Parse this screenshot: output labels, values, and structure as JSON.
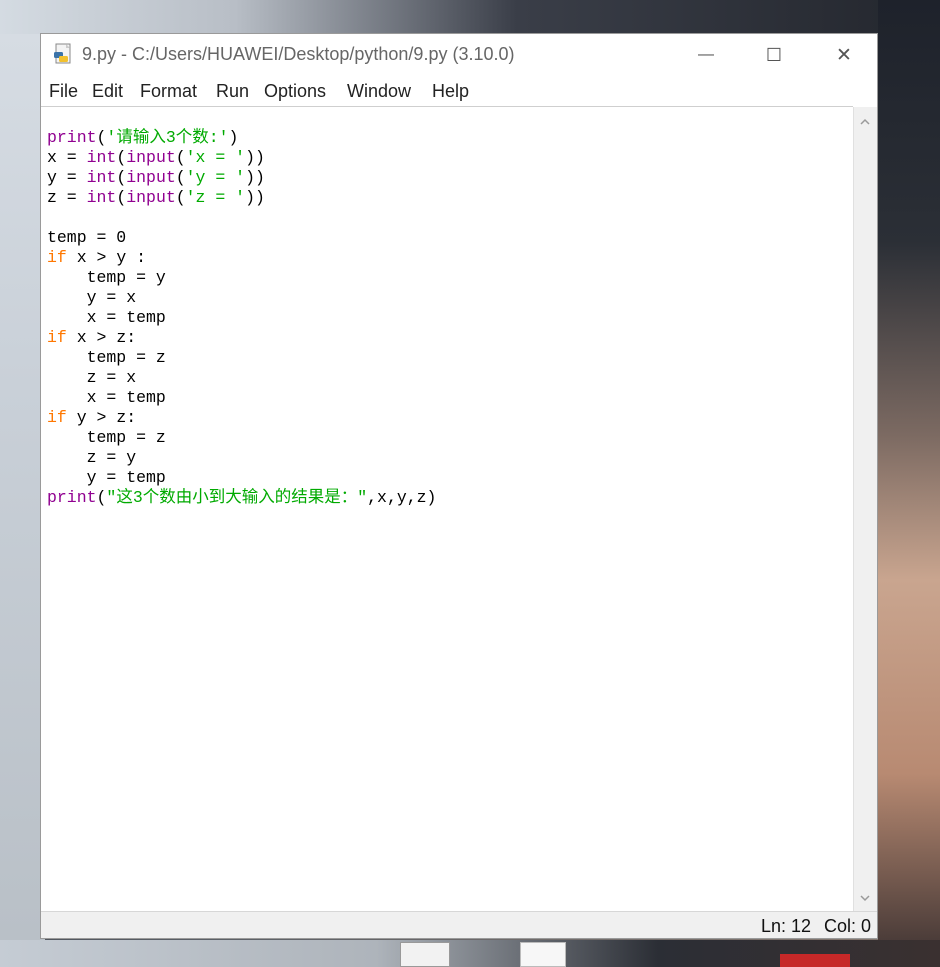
{
  "window": {
    "title": "9.py - C:/Users/HUAWEI/Desktop/python/9.py (3.10.0)",
    "controls": {
      "minimize": "—",
      "maximize": "☐",
      "close": "✕"
    }
  },
  "menu": [
    "File",
    "Edit",
    "Format",
    "Run",
    "Options",
    "Window",
    "Help"
  ],
  "code": [
    [
      {
        "t": "print",
        "c": "purple"
      },
      {
        "t": "(",
        "c": "plain"
      },
      {
        "t": "'请输入3个数:'",
        "c": "green"
      },
      {
        "t": ")",
        "c": "plain"
      }
    ],
    [
      {
        "t": "x = ",
        "c": "plain"
      },
      {
        "t": "int",
        "c": "purple"
      },
      {
        "t": "(",
        "c": "plain"
      },
      {
        "t": "input",
        "c": "purple"
      },
      {
        "t": "(",
        "c": "plain"
      },
      {
        "t": "'x = '",
        "c": "green"
      },
      {
        "t": "))",
        "c": "plain"
      }
    ],
    [
      {
        "t": "y = ",
        "c": "plain"
      },
      {
        "t": "int",
        "c": "purple"
      },
      {
        "t": "(",
        "c": "plain"
      },
      {
        "t": "input",
        "c": "purple"
      },
      {
        "t": "(",
        "c": "plain"
      },
      {
        "t": "'y = '",
        "c": "green"
      },
      {
        "t": "))",
        "c": "plain"
      }
    ],
    [
      {
        "t": "z = ",
        "c": "plain"
      },
      {
        "t": "int",
        "c": "purple"
      },
      {
        "t": "(",
        "c": "plain"
      },
      {
        "t": "input",
        "c": "purple"
      },
      {
        "t": "(",
        "c": "plain"
      },
      {
        "t": "'z = '",
        "c": "green"
      },
      {
        "t": "))",
        "c": "plain"
      }
    ],
    [],
    [
      {
        "t": "temp = 0",
        "c": "plain"
      }
    ],
    [
      {
        "t": "if",
        "c": "orange"
      },
      {
        "t": " x > y :",
        "c": "plain"
      }
    ],
    [
      {
        "t": "    temp = y",
        "c": "plain"
      }
    ],
    [
      {
        "t": "    y = x",
        "c": "plain"
      }
    ],
    [
      {
        "t": "    x = temp",
        "c": "plain"
      }
    ],
    [
      {
        "t": "if",
        "c": "orange"
      },
      {
        "t": " x > z:",
        "c": "plain"
      }
    ],
    [
      {
        "t": "    temp = z",
        "c": "plain"
      }
    ],
    [
      {
        "t": "    z = x",
        "c": "plain"
      }
    ],
    [
      {
        "t": "    x = temp",
        "c": "plain"
      }
    ],
    [
      {
        "t": "if",
        "c": "orange"
      },
      {
        "t": " y > z:",
        "c": "plain"
      }
    ],
    [
      {
        "t": "    temp = z",
        "c": "plain"
      }
    ],
    [
      {
        "t": "    z = y",
        "c": "plain"
      }
    ],
    [
      {
        "t": "    y = temp",
        "c": "plain"
      }
    ],
    [
      {
        "t": "print",
        "c": "purple"
      },
      {
        "t": "(",
        "c": "plain"
      },
      {
        "t": "\"这3个数由小到大输入的结果是：\"",
        "c": "green"
      },
      {
        "t": ",x,y,z)",
        "c": "plain"
      }
    ]
  ],
  "status": {
    "line": "Ln: 12",
    "col": "Col: 0"
  },
  "colors": {
    "purple": "#900090",
    "orange": "#ff7700",
    "green": "#00aa00"
  },
  "icons": [
    "python-file-icon",
    "scroll-up-icon",
    "scroll-down-icon"
  ]
}
